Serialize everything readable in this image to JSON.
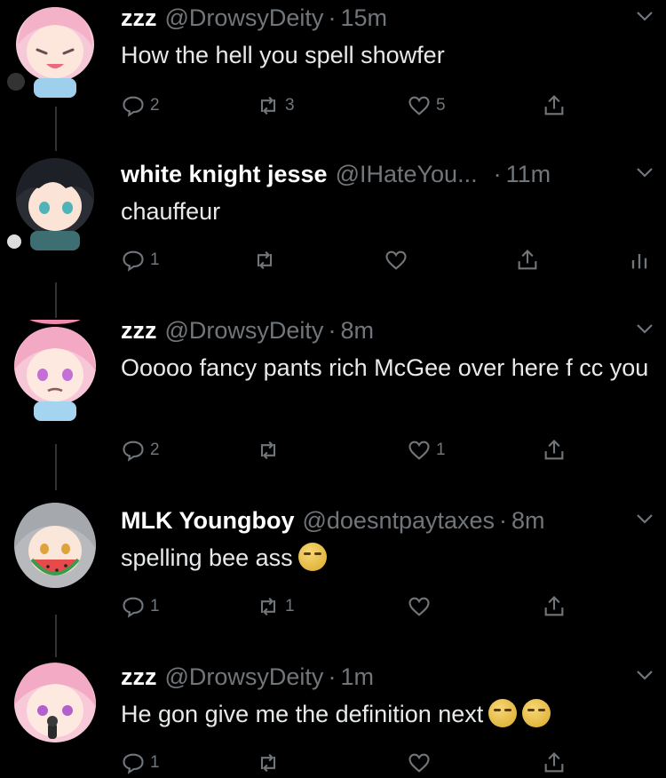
{
  "tweets": [
    {
      "display_name": "zzz",
      "handle": "@DrowsyDeity",
      "time": "15m",
      "text": "How the hell you spell showfer",
      "emoji_count": 0,
      "replies": "2",
      "retweets": "3",
      "likes": "5",
      "show_views": false
    },
    {
      "display_name": "white knight jesse",
      "handle": "@IHateYou...",
      "time": "11m",
      "text": "chauffeur",
      "emoji_count": 0,
      "replies": "1",
      "retweets": "",
      "likes": "",
      "show_views": true
    },
    {
      "display_name": "zzz",
      "handle": "@DrowsyDeity",
      "time": "8m",
      "text": "Ooooo fancy pants rich McGee over here f  cc you",
      "emoji_count": 0,
      "replies": "2",
      "retweets": "",
      "likes": "1",
      "show_views": false
    },
    {
      "display_name": "MLK Youngboy",
      "handle": "@doesntpaytaxes",
      "time": "8m",
      "text": "spelling bee ass",
      "emoji_count": 1,
      "replies": "1",
      "retweets": "1",
      "likes": "",
      "show_views": false
    },
    {
      "display_name": "zzz",
      "handle": "@DrowsyDeity",
      "time": "1m",
      "text": "He gon give me the definition next",
      "emoji_count": 2,
      "replies": "1",
      "retweets": "",
      "likes": "",
      "show_views": false
    }
  ],
  "separator": "·",
  "icons": {
    "avatar_1": "pink-hair-anime-avatar-icon",
    "avatar_2": "black-hair-anime-avatar-icon",
    "avatar_3": "pink-hair-halo-anime-avatar-icon",
    "avatar_4": "silver-hair-watermelon-avatar-icon",
    "avatar_5": "pink-hair-microphone-avatar-icon",
    "reply": "reply-icon",
    "retweet": "retweet-icon",
    "like": "heart-icon",
    "share": "share-icon",
    "views": "views-icon",
    "more": "chevron-down-icon"
  },
  "colors": {
    "background": "#000000",
    "text": "#e7e9ea",
    "muted": "#71767b",
    "thread_line": "#2f3336"
  }
}
